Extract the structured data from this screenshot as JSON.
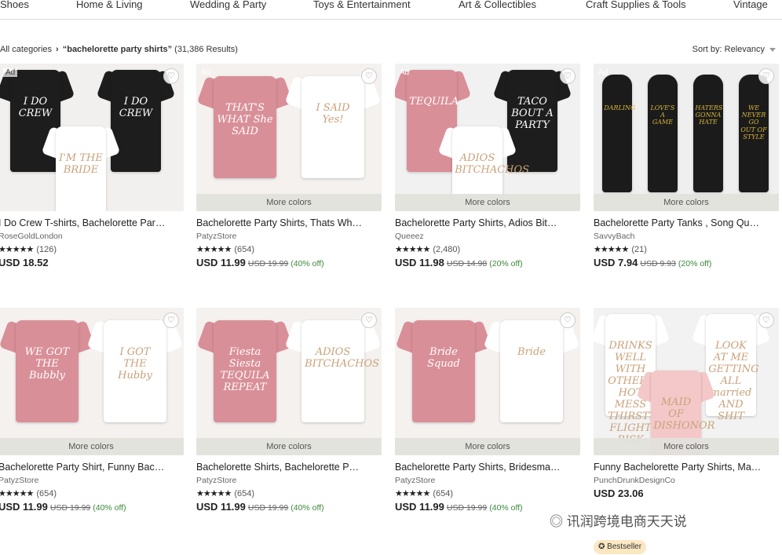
{
  "nav": {
    "categories": [
      "Shoes",
      "Home & Living",
      "Wedding & Party",
      "Toys & Entertainment",
      "Art & Collectibles",
      "Craft Supplies & Tools",
      "Vintage"
    ]
  },
  "breadcrumb": {
    "root": "All categories",
    "query": "“bachelorette party shirts”",
    "results": "(31,386 Results)"
  },
  "sort": {
    "label": "Sort by: Relevancy"
  },
  "common": {
    "more_colors": "More colors",
    "ad": "Ad",
    "currency": "USD"
  },
  "products": [
    {
      "title": "I Do Crew T-shirts, Bachelorette Par…",
      "shop": "RoseGoldLondon",
      "reviews": "(126)",
      "price": "USD 18.52",
      "old_price": "",
      "discount": "",
      "ad": true,
      "more_colors": false,
      "art": {
        "bg": "#f2f0ee",
        "shirts": [
          "#1d1d1d",
          "#1d1d1d",
          "#ffffff"
        ],
        "texts": [
          "I DO CREW",
          "I DO CREW",
          "I'M THE BRIDE"
        ]
      }
    },
    {
      "title": "Bachelorette Party Shirts, Thats Wh…",
      "shop": "PatyzStore",
      "reviews": "(654)",
      "price": "USD 11.99",
      "old_price": "USD 19.99",
      "discount": "(40% off)",
      "ad": true,
      "more_colors": true,
      "art": {
        "bg": "#f4f1ef",
        "shirts": [
          "#d98f98",
          "#ffffff"
        ],
        "texts": [
          "THAT'S WHAT She SAID",
          "I SAID Yes!"
        ]
      }
    },
    {
      "title": "Bachelorette Party Shirts, Adios Bit…",
      "shop": "Queeez",
      "reviews": "(2,480)",
      "price": "USD 11.98",
      "old_price": "USD 14.98",
      "discount": "(20% off)",
      "ad": true,
      "more_colors": true,
      "art": {
        "bg": "#f1f1f1",
        "shirts": [
          "#d98f98",
          "#1d1d1d",
          "#ffffff"
        ],
        "texts": [
          "TEQUILA",
          "TACO BOUT A PARTY",
          "ADIOS BITCHACHOS"
        ]
      }
    },
    {
      "title": "Bachelorette Party Tanks , Song Qu…",
      "shop": "SavvyBach",
      "reviews": "(21)",
      "price": "USD 7.94",
      "old_price": "USD 9.93",
      "discount": "(20% off)",
      "ad": true,
      "more_colors": true,
      "art": {
        "bg": "#efefef",
        "shirts": [
          "#1b1b1b",
          "#1b1b1b",
          "#1b1b1b",
          "#1b1b1b"
        ],
        "texts": [
          "DARLING",
          "LOVE'S A GAME",
          "HATERS GONNA HATE",
          "WE NEVER GO OUT OF STYLE"
        ]
      }
    },
    {
      "title": "Bachelorette Party Shirt, Funny Bac…",
      "shop": "PatyzStore",
      "reviews": "(654)",
      "price": "USD 11.99",
      "old_price": "USD 19.99",
      "discount": "(40% off)",
      "ad": false,
      "more_colors": true,
      "art": {
        "bg": "#f4f1ef",
        "shirts": [
          "#d98f98",
          "#ffffff"
        ],
        "texts": [
          "WE GOT THE Bubbly",
          "I GOT THE Hubby"
        ]
      }
    },
    {
      "title": "Bachelorette Shirts, Bachelorette P…",
      "shop": "PatyzStore",
      "reviews": "(654)",
      "price": "USD 11.99",
      "old_price": "USD 19.99",
      "discount": "(40% off)",
      "ad": false,
      "more_colors": true,
      "art": {
        "bg": "#f4f1ef",
        "shirts": [
          "#d98f98",
          "#ffffff"
        ],
        "texts": [
          "Fiesta Siesta TEQUILA REPEAT",
          "ADIOS BITCHACHOS"
        ]
      }
    },
    {
      "title": "Bachelorette Party Shirts, Bridesma…",
      "shop": "PatyzStore",
      "reviews": "(654)",
      "price": "USD 11.99",
      "old_price": "USD 19.99",
      "discount": "(40% off)",
      "ad": false,
      "more_colors": true,
      "art": {
        "bg": "#f4f1ef",
        "shirts": [
          "#d98f98",
          "#ffffff"
        ],
        "texts": [
          "Bride Squad",
          "Bride"
        ]
      }
    },
    {
      "title": "Funny Bachelorette Party Shirts, Ma…",
      "shop": "PunchDrunkDesignCo",
      "reviews": "",
      "price": "USD 23.06",
      "old_price": "",
      "discount": "",
      "ad": false,
      "more_colors": true,
      "art": {
        "bg": "#f2f2f2",
        "shirts": [
          "#ffffff",
          "#ffffff",
          "#f4c8c8"
        ],
        "texts": [
          "DRINKS WELL WITH OTHERS HOT MESS THIRSTY FLIGHT RISK",
          "LOOK AT ME GETTING ALL married AND SHIT",
          "MAID OF DISHONOR"
        ]
      }
    }
  ],
  "bestseller": "Bestseller",
  "watermark": "讯润跨境电商天天说"
}
